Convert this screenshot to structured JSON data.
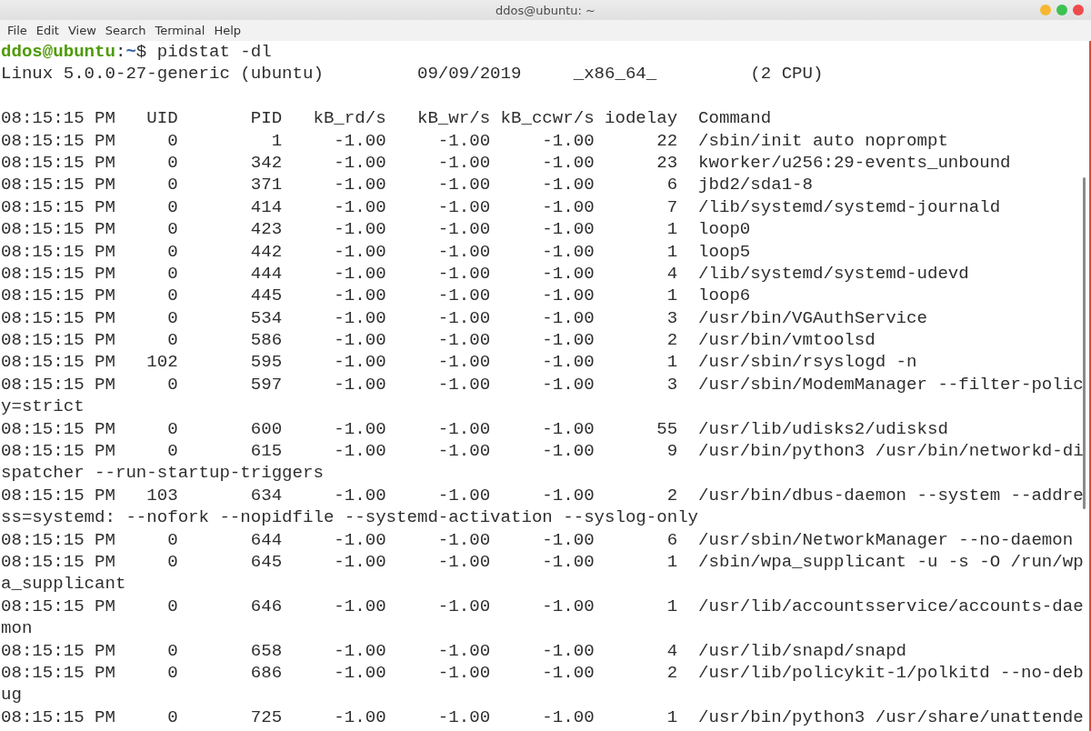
{
  "window": {
    "title": "ddos@ubuntu: ~"
  },
  "menu": [
    "File",
    "Edit",
    "View",
    "Search",
    "Terminal",
    "Help"
  ],
  "prompt": {
    "user_host": "ddos@ubuntu",
    "separator": ":",
    "path": "~",
    "symbol": "$",
    "command": "pidstat -dl"
  },
  "lines": [
    {
      "kind": "text",
      "text": "Linux 5.0.0-27-generic (ubuntu)         09/09/2019     _x86_64_         (2 CPU)"
    },
    {
      "kind": "blank"
    },
    {
      "kind": "text",
      "text": "08:15:15 PM   UID       PID   kB_rd/s   kB_wr/s kB_ccwr/s iodelay  Command"
    },
    {
      "kind": "text",
      "text": "08:15:15 PM     0         1     -1.00     -1.00     -1.00      22  /sbin/init auto noprompt"
    },
    {
      "kind": "text",
      "text": "08:15:15 PM     0       342     -1.00     -1.00     -1.00      23  kworker/u256:29-events_unbound"
    },
    {
      "kind": "text",
      "text": "08:15:15 PM     0       371     -1.00     -1.00     -1.00       6  jbd2/sda1-8"
    },
    {
      "kind": "text",
      "text": "08:15:15 PM     0       414     -1.00     -1.00     -1.00       7  /lib/systemd/systemd-journald"
    },
    {
      "kind": "text",
      "text": "08:15:15 PM     0       423     -1.00     -1.00     -1.00       1  loop0"
    },
    {
      "kind": "text",
      "text": "08:15:15 PM     0       442     -1.00     -1.00     -1.00       1  loop5"
    },
    {
      "kind": "text",
      "text": "08:15:15 PM     0       444     -1.00     -1.00     -1.00       4  /lib/systemd/systemd-udevd"
    },
    {
      "kind": "text",
      "text": "08:15:15 PM     0       445     -1.00     -1.00     -1.00       1  loop6"
    },
    {
      "kind": "text",
      "text": "08:15:15 PM     0       534     -1.00     -1.00     -1.00       3  /usr/bin/VGAuthService"
    },
    {
      "kind": "text",
      "text": "08:15:15 PM     0       586     -1.00     -1.00     -1.00       2  /usr/bin/vmtoolsd"
    },
    {
      "kind": "text",
      "text": "08:15:15 PM   102       595     -1.00     -1.00     -1.00       1  /usr/sbin/rsyslogd -n"
    },
    {
      "kind": "text",
      "text": "08:15:15 PM     0       597     -1.00     -1.00     -1.00       3  /usr/sbin/ModemManager --filter-polic"
    },
    {
      "kind": "text",
      "text": "y=strict"
    },
    {
      "kind": "text",
      "text": "08:15:15 PM     0       600     -1.00     -1.00     -1.00      55  /usr/lib/udisks2/udisksd"
    },
    {
      "kind": "text",
      "text": "08:15:15 PM     0       615     -1.00     -1.00     -1.00       9  /usr/bin/python3 /usr/bin/networkd-di"
    },
    {
      "kind": "text",
      "text": "spatcher --run-startup-triggers"
    },
    {
      "kind": "text",
      "text": "08:15:15 PM   103       634     -1.00     -1.00     -1.00       2  /usr/bin/dbus-daemon --system --addre"
    },
    {
      "kind": "text",
      "text": "ss=systemd: --nofork --nopidfile --systemd-activation --syslog-only"
    },
    {
      "kind": "text",
      "text": "08:15:15 PM     0       644     -1.00     -1.00     -1.00       6  /usr/sbin/NetworkManager --no-daemon"
    },
    {
      "kind": "text",
      "text": "08:15:15 PM     0       645     -1.00     -1.00     -1.00       1  /sbin/wpa_supplicant -u -s -O /run/wp"
    },
    {
      "kind": "text",
      "text": "a_supplicant"
    },
    {
      "kind": "text",
      "text": "08:15:15 PM     0       646     -1.00     -1.00     -1.00       1  /usr/lib/accountsservice/accounts-dae"
    },
    {
      "kind": "text",
      "text": "mon"
    },
    {
      "kind": "text",
      "text": "08:15:15 PM     0       658     -1.00     -1.00     -1.00       4  /usr/lib/snapd/snapd"
    },
    {
      "kind": "text",
      "text": "08:15:15 PM     0       686     -1.00     -1.00     -1.00       2  /usr/lib/policykit-1/polkitd --no-deb"
    },
    {
      "kind": "text",
      "text": "ug"
    },
    {
      "kind": "text",
      "text": "08:15:15 PM     0       725     -1.00     -1.00     -1.00       1  /usr/bin/python3 /usr/share/unattende"
    }
  ]
}
